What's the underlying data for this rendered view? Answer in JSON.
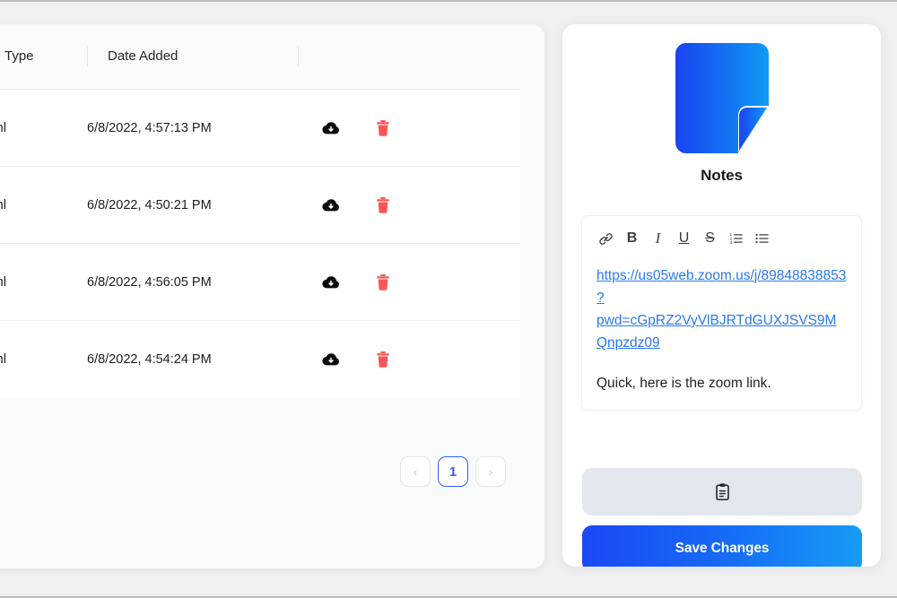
{
  "files_panel": {
    "columns": [
      {
        "key": "type",
        "label": "Type"
      },
      {
        "key": "date",
        "label": "Date Added"
      },
      {
        "key": "actions",
        "label": ""
      }
    ],
    "rows": [
      {
        "type": "Xml",
        "date": "6/8/2022, 4:57:13 PM",
        "download_icon": "cloud-download-icon",
        "delete_icon": "trash-icon"
      },
      {
        "type": "Xml",
        "date": "6/8/2022, 4:50:21 PM",
        "download_icon": "cloud-download-icon",
        "delete_icon": "trash-icon"
      },
      {
        "type": "Xml",
        "date": "6/8/2022, 4:56:05 PM",
        "download_icon": "cloud-download-icon",
        "delete_icon": "trash-icon"
      },
      {
        "type": "Xml",
        "date": "6/8/2022, 4:54:24 PM",
        "download_icon": "cloud-download-icon",
        "delete_icon": "trash-icon"
      }
    ],
    "pagination": {
      "prev_label": "‹",
      "prev_icon": "chevron-left-icon",
      "next_label": "›",
      "next_icon": "chevron-right-icon",
      "pages": [
        "1"
      ],
      "current_page": "1"
    }
  },
  "notes_panel": {
    "icon_name": "notes-document-icon",
    "title": "Notes",
    "toolbar": [
      {
        "name": "link-icon",
        "label": "🔗",
        "style": "link"
      },
      {
        "name": "bold-icon",
        "label": "B",
        "style": "bold"
      },
      {
        "name": "italic-icon",
        "label": "I",
        "style": "italic"
      },
      {
        "name": "underline-icon",
        "label": "U",
        "style": "under"
      },
      {
        "name": "strikethrough-icon",
        "label": "S",
        "style": "strike"
      },
      {
        "name": "ordered-list-icon",
        "label": "",
        "style": "ol"
      },
      {
        "name": "bullet-list-icon",
        "label": "",
        "style": "ul"
      }
    ],
    "content": {
      "link_text": "https://us05web.zoom.us/j/89848838853?pwd=cGpRZ2VyVlBJRTdGUXJSVS9MQnpzdz09",
      "body_text": "Quick, here is the zoom link."
    },
    "copy_button": {
      "icon": "clipboard-icon",
      "label": ""
    },
    "save_button": {
      "label": "Save Changes"
    }
  },
  "colors": {
    "page_background": "#eff0f2",
    "card_background": "#ffffff",
    "table_header_background": "#f9fafa",
    "link_blue": "#2979f2",
    "accent_blue": "#2e5cf6",
    "delete_red": "#fb5555",
    "gradient_start": "#1a49f5",
    "gradient_end": "#179cf5",
    "copy_button_background": "#e2e7ee"
  }
}
